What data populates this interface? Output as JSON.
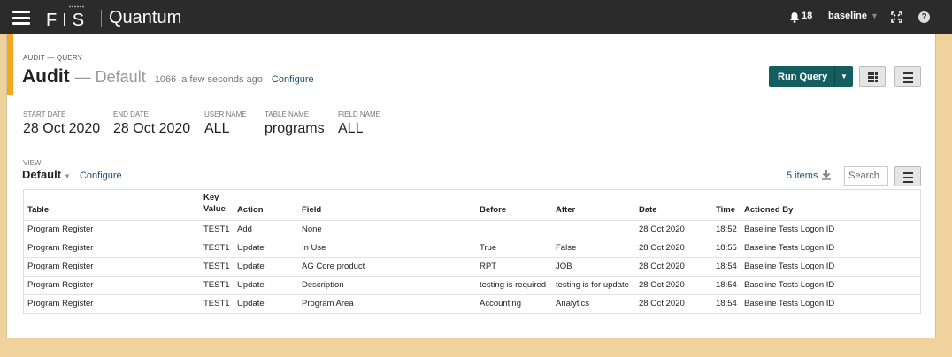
{
  "topbar": {
    "brand": "FIS",
    "app_title": "Quantum",
    "notification_count": "18",
    "user": "baseline"
  },
  "header": {
    "eyebrow": "AUDIT — QUERY",
    "title": "Audit",
    "subtitle": "— Default",
    "record_count": "1066",
    "updated": "a few seconds ago",
    "configure_label": "Configure",
    "run_query_label": "Run Query"
  },
  "params": [
    {
      "label": "START DATE",
      "value": "28 Oct 2020"
    },
    {
      "label": "END DATE",
      "value": "28 Oct 2020"
    },
    {
      "label": "USER NAME",
      "value": "ALL"
    },
    {
      "label": "TABLE NAME",
      "value": "programs"
    },
    {
      "label": "FIELD NAME",
      "value": "ALL"
    }
  ],
  "view": {
    "label": "VIEW",
    "value": "Default",
    "configure_label": "Configure",
    "items_count": "5 items",
    "search_placeholder": "Search"
  },
  "table": {
    "columns": [
      "Table",
      "Key Value",
      "Action",
      "Field",
      "Before",
      "After",
      "Date",
      "Time",
      "Actioned By"
    ],
    "rows": [
      [
        "Program Register",
        "TEST1",
        "Add",
        "None",
        "",
        "",
        "28 Oct 2020",
        "18:52",
        "Baseline Tests Logon ID"
      ],
      [
        "Program Register",
        "TEST1",
        "Update",
        "In Use",
        "True",
        "False",
        "28 Oct 2020",
        "18:55",
        "Baseline Tests Logon ID"
      ],
      [
        "Program Register",
        "TEST1",
        "Update",
        "AG Core product",
        "RPT",
        "JOB",
        "28 Oct 2020",
        "18:54",
        "Baseline Tests Logon ID"
      ],
      [
        "Program Register",
        "TEST1",
        "Update",
        "Description",
        "testing is required",
        "testing is for update",
        "28 Oct 2020",
        "18:54",
        "Baseline Tests Logon ID"
      ],
      [
        "Program Register",
        "TEST1",
        "Update",
        "Program Area",
        "Accounting",
        "Analytics",
        "28 Oct 2020",
        "18:54",
        "Baseline Tests Logon ID"
      ]
    ]
  },
  "colors": {
    "topbar": "#2b2b2b",
    "accent": "#f5a623",
    "primary_button": "#155e5f",
    "link": "#1a4f78",
    "background": "#f0d29c"
  },
  "icons": [
    "menu-icon",
    "bell-icon",
    "expand-icon",
    "help-icon",
    "grid-icon",
    "list-icon",
    "download-icon"
  ]
}
